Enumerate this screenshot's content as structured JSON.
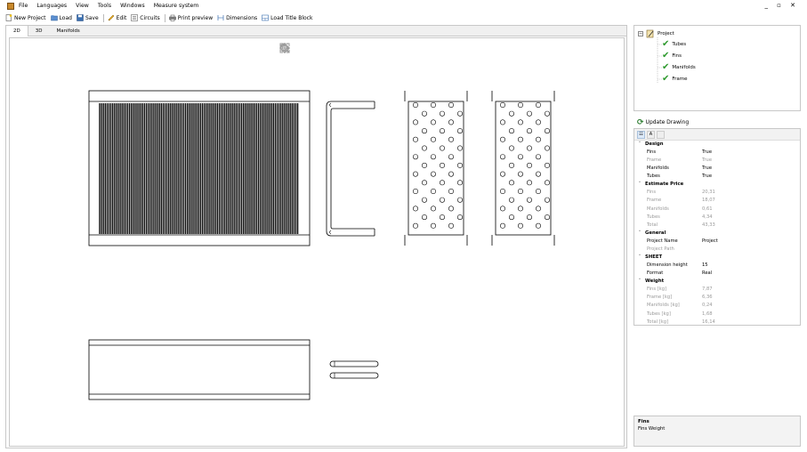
{
  "menu": {
    "items": [
      "File",
      "Languages",
      "View",
      "Tools",
      "Windows",
      "Measure system"
    ],
    "window_controls": "_ ▫ ✕"
  },
  "toolbar": {
    "new_project": "New Project",
    "load": "Load",
    "save": "Save",
    "edit": "Edit",
    "circuits": "Circuits",
    "print_preview": "Print preview",
    "dimensions": "Dimensions",
    "load_title_block": "Load Title Block"
  },
  "tabs": [
    "2D",
    "3D",
    "Manifolds"
  ],
  "view_tools": [
    "zoom-window-icon",
    "zoom-icon",
    "pan-icon",
    "rotate-icon",
    "fit-extents-icon"
  ],
  "tree": {
    "root": "Project",
    "children": [
      "Tubes",
      "Fins",
      "Manifolds",
      "Frame"
    ]
  },
  "update_drawing": "Update Drawing",
  "properties": {
    "design": {
      "label": "Design",
      "rows": [
        {
          "name": "Fins",
          "value": "True",
          "readonly": false
        },
        {
          "name": "Frame",
          "value": "True",
          "readonly": true
        },
        {
          "name": "Manifolds",
          "value": "True",
          "readonly": false
        },
        {
          "name": "Tubes",
          "value": "True",
          "readonly": false
        }
      ]
    },
    "estimate_price": {
      "label": "Estimate Price",
      "rows": [
        {
          "name": "Fins",
          "value": "20,31"
        },
        {
          "name": "Frame",
          "value": "18,07"
        },
        {
          "name": "Manifolds",
          "value": "0,61"
        },
        {
          "name": "Tubes",
          "value": "4,34"
        },
        {
          "name": "Total",
          "value": "43,33"
        }
      ]
    },
    "general": {
      "label": "General",
      "rows": [
        {
          "name": "Project Name",
          "value": "Project",
          "readonly": false
        },
        {
          "name": "Project Path",
          "value": "",
          "readonly": true
        }
      ]
    },
    "sheet": {
      "label": "SHEET",
      "rows": [
        {
          "name": "Dimension height",
          "value": "15"
        },
        {
          "name": "Format",
          "value": "Real"
        }
      ]
    },
    "weight": {
      "label": "Weight",
      "rows": [
        {
          "name": "Fins [kg]",
          "value": "7,87"
        },
        {
          "name": "Frame [kg]",
          "value": "6,36"
        },
        {
          "name": "Manifolds [kg]",
          "value": "0,24"
        },
        {
          "name": "Tubes [kg]",
          "value": "1,68"
        },
        {
          "name": "Total [kg]",
          "value": "16,14"
        }
      ]
    }
  },
  "description": {
    "title": "Fins",
    "text": "Fins Weight"
  },
  "colors": {
    "check": "#2e9a2e",
    "fin_black": "#000000",
    "grid_border": "#c8c8c8"
  }
}
